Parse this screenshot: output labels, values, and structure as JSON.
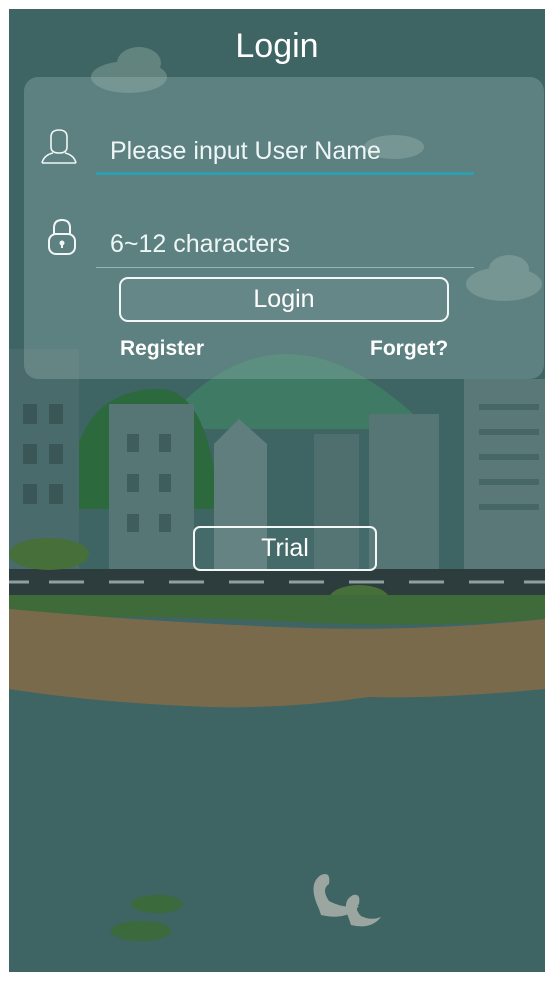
{
  "header": {
    "title": "Login"
  },
  "form": {
    "username": {
      "value": "",
      "placeholder": "Please input User Name",
      "icon": "user-icon",
      "active_color": "#2f9fb0"
    },
    "password": {
      "value": "",
      "placeholder": "6~12 characters",
      "icon": "lock-icon"
    },
    "login_label": "Login",
    "register_label": "Register",
    "forget_label": "Forget?"
  },
  "trial_label": "Trial",
  "colors": {
    "background": "#3e6464",
    "card": "rgba(160,190,190,0.32)",
    "text": "#ffffff"
  }
}
